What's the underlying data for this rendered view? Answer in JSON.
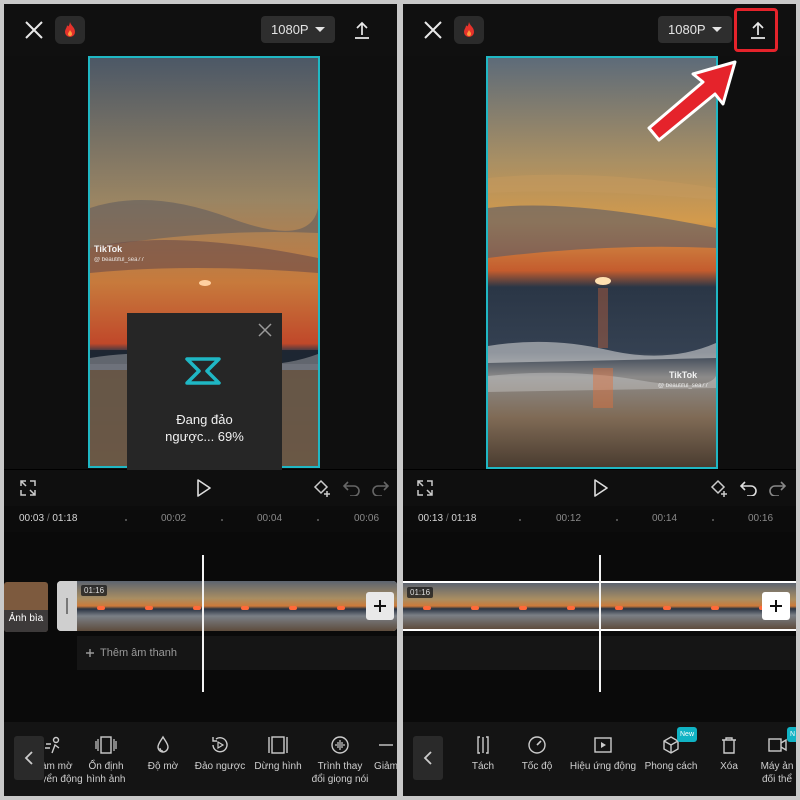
{
  "left": {
    "resolution": "1080P",
    "timecode_current": "00:03",
    "timecode_total": "01:18",
    "ruler_ticks": [
      "00:02",
      "00:04",
      "00:06"
    ],
    "watermark": {
      "brand": "TikTok",
      "user": "@ beautiful_sea77"
    },
    "clip_duration": "01:16",
    "cover_label": "Ảnh bìa",
    "add_audio_label": "Thêm âm thanh",
    "dialog": {
      "line1": "Đang đảo",
      "line2": "ngược... 69%",
      "progress_percent": 69
    },
    "tools": [
      {
        "label1": "Làm mờ",
        "label2": "chuyển động",
        "icon": "blur-person-icon"
      },
      {
        "label1": "Ổn định",
        "label2": "hình ảnh",
        "icon": "stabilize-icon"
      },
      {
        "label1": "Độ mờ",
        "label2": "",
        "icon": "opacity-drop-icon"
      },
      {
        "label1": "Đảo ngược",
        "label2": "",
        "icon": "reverse-icon"
      },
      {
        "label1": "Dừng hình",
        "label2": "",
        "icon": "freeze-icon"
      },
      {
        "label1": "Trình thay",
        "label2": "đổi giọng nói",
        "icon": "voice-changer-icon"
      },
      {
        "label1": "Giảm",
        "label2": "",
        "icon": "reduce-icon"
      }
    ]
  },
  "right": {
    "resolution": "1080P",
    "timecode_current": "00:13",
    "timecode_total": "01:18",
    "ruler_ticks": [
      "00:12",
      "00:14",
      "00:16"
    ],
    "watermark": {
      "brand": "TikTok",
      "user": "@ beautiful_sea77"
    },
    "clip_duration": "01:16",
    "tools": [
      {
        "label1": "Tách",
        "label2": "",
        "icon": "split-icon"
      },
      {
        "label1": "Tốc độ",
        "label2": "",
        "icon": "speed-icon"
      },
      {
        "label1": "Hiệu ứng động",
        "label2": "",
        "icon": "animation-icon"
      },
      {
        "label1": "Phong cách",
        "label2": "",
        "icon": "style-cube-icon",
        "badge": "New"
      },
      {
        "label1": "Xóa",
        "label2": "",
        "icon": "delete-icon"
      },
      {
        "label1": "Máy ản",
        "label2": "đối thể",
        "icon": "camera-icon",
        "badge": "N"
      }
    ]
  },
  "colors": {
    "accent": "#1fb7c4",
    "annotation_red": "#e5232b",
    "background": "#000000"
  }
}
